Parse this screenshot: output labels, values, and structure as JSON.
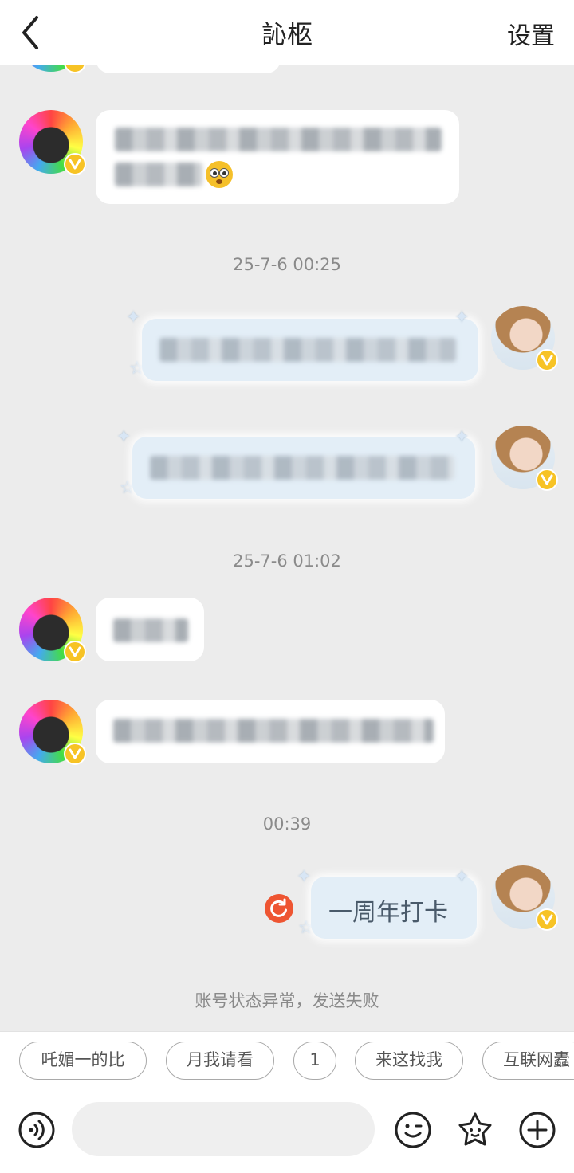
{
  "header": {
    "title": "訫柩",
    "settings_label": "设置"
  },
  "timestamps": [
    "25-7-6 00:25",
    "25-7-6 01:02",
    "00:39"
  ],
  "sent_message": "一周年打卡",
  "send_status": "账号状态异常，发送失败",
  "quick_replies": [
    "吒媚一的比",
    "月我请看",
    "1",
    "来这找我",
    "互联网蠹"
  ],
  "colors": {
    "badge": "#f7c325",
    "retry": "#ee5532",
    "background": "#ececec"
  },
  "icons": {
    "back": "chevron-left-icon",
    "voice": "voice-icon",
    "emoji": "smiley-icon",
    "sticker": "star-sticker-icon",
    "add": "plus-icon",
    "retry": "retry-icon",
    "verified": "verified-v-icon"
  }
}
